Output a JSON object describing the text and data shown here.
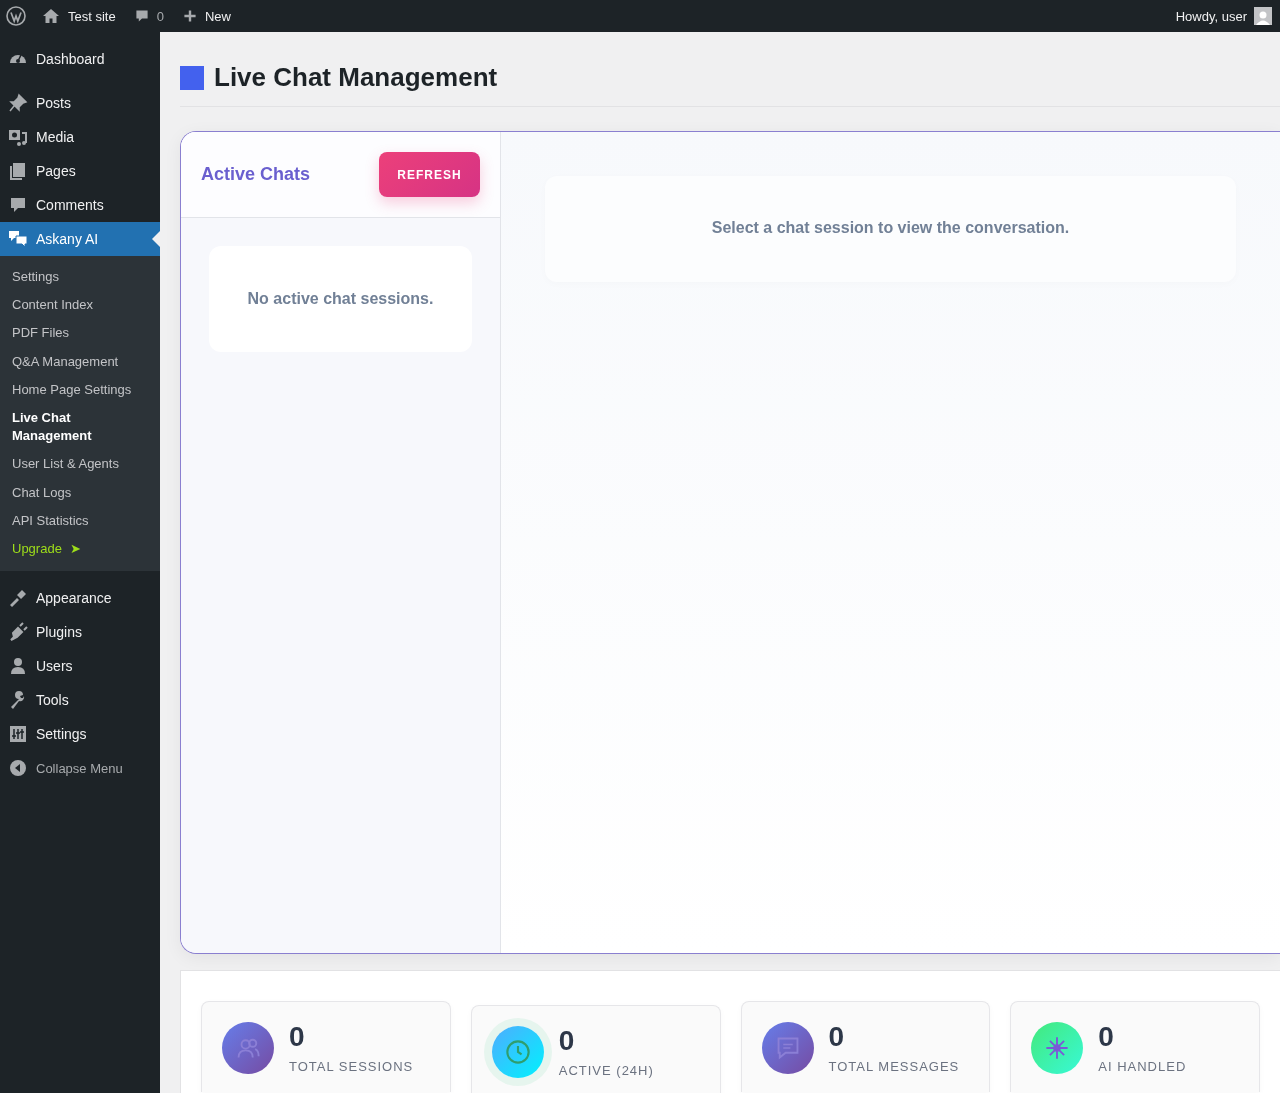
{
  "admin_bar": {
    "site": "Test site",
    "comments": "0",
    "new": "New",
    "greeting": "Howdy, user"
  },
  "sidebar": {
    "items": [
      {
        "label": "Dashboard",
        "selected": false
      },
      {
        "label": "Posts",
        "selected": false
      },
      {
        "label": "Media",
        "selected": false
      },
      {
        "label": "Pages",
        "selected": false
      },
      {
        "label": "Comments",
        "selected": false
      },
      {
        "label": "Askany AI",
        "selected": true,
        "children": [
          {
            "label": "Settings",
            "selected": false,
            "kind": "link"
          },
          {
            "label": "Content Index",
            "selected": false,
            "kind": "link"
          },
          {
            "label": "PDF Files",
            "selected": false,
            "kind": "link"
          },
          {
            "label": "Q&A Management",
            "selected": false,
            "kind": "link"
          },
          {
            "label": "Home Page Settings",
            "selected": false,
            "kind": "link"
          },
          {
            "label": "Live Chat Management",
            "selected": true,
            "kind": "link"
          },
          {
            "label": "User List & Agents",
            "selected": false,
            "kind": "link"
          },
          {
            "label": "Chat Logs",
            "selected": false,
            "kind": "link"
          },
          {
            "label": "API Statistics",
            "selected": false,
            "kind": "link"
          },
          {
            "label": "Upgrade",
            "selected": false,
            "kind": "upgrade",
            "arrow": "➤"
          }
        ]
      },
      {
        "label": "Appearance",
        "selected": false
      },
      {
        "label": "Plugins",
        "selected": false
      },
      {
        "label": "Users",
        "selected": false
      },
      {
        "label": "Tools",
        "selected": false
      },
      {
        "label": "Settings",
        "selected": false
      }
    ],
    "collapse": "Collapse Menu"
  },
  "page": {
    "title": "Live Chat Management"
  },
  "chats": {
    "heading": "Active Chats",
    "refresh": "REFRESH",
    "empty": "No active chat sessions.",
    "prompt": "Select a chat session to view the conversation."
  },
  "stats": [
    {
      "value": "0",
      "label": "TOTAL SESSIONS"
    },
    {
      "value": "0",
      "label": "ACTIVE (24H)"
    },
    {
      "value": "0",
      "label": "TOTAL MESSAGES"
    },
    {
      "value": "0",
      "label": "AI HANDLED"
    }
  ]
}
